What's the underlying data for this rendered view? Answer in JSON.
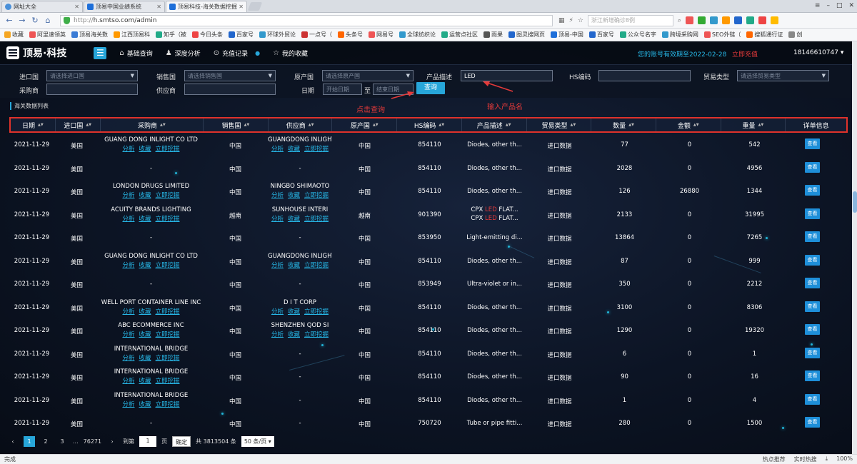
{
  "browser": {
    "tabs": [
      {
        "title": "网址大全",
        "color": "#4a90d9"
      },
      {
        "title": "顶易中国业绩系统",
        "color": "#1e6fd9"
      },
      {
        "title": "顶易科技-海关数据挖掘",
        "color": "#1e6fd9"
      }
    ],
    "window_controls": [
      "≡",
      "–",
      "□",
      "✕"
    ],
    "url_protocol": "http://",
    "url_host": "h.smtso.com/admin",
    "search_placeholder": "浙江新增确诊8例",
    "bookmarks": [
      "收藏",
      "阿里速领英",
      "顶易海关数",
      "江西顶易科",
      "知乎（被",
      "今日头条",
      "百家号",
      "环球外贸论",
      "一点号（",
      "头条号",
      "网易号",
      "全球纺织论",
      "运营点社区",
      "雨果",
      "图灵搜网页",
      "顶易-中国",
      "百家号",
      "公众号名字",
      "跨境采购网",
      "SEO外链（",
      "搜狐通行证",
      "创"
    ]
  },
  "app": {
    "brand": "顶易·科技",
    "nav": [
      {
        "icon": "⌂",
        "label": "基础查询"
      },
      {
        "icon": "♟",
        "label": "深度分析"
      },
      {
        "icon": "⊙",
        "label": "充值记录"
      },
      {
        "icon": "☆",
        "label": "我的收藏"
      }
    ],
    "account_expiry": "您的账号有效期至2022-02-28",
    "renew_label": "立即充值",
    "username": "18146610747",
    "filters": {
      "import_country": {
        "label": "进口国",
        "placeholder": "请选择进口国"
      },
      "export_country": {
        "label": "销售国",
        "placeholder": "请选择销售国"
      },
      "origin_country": {
        "label": "原产国",
        "placeholder": "请选择原产国"
      },
      "product_desc": {
        "label": "产品描述",
        "value": "LED"
      },
      "hs_code": {
        "label": "HS编码",
        "value": ""
      },
      "trade_type": {
        "label": "贸易类型",
        "placeholder": "请选择贸易类型"
      },
      "buyer": {
        "label": "采购商",
        "value": ""
      },
      "supplier": {
        "label": "供应商",
        "value": ""
      },
      "date": {
        "label": "日期",
        "start_placeholder": "开始日期",
        "to": "至",
        "end_placeholder": "结束日期"
      },
      "query_button": "查询"
    },
    "annotations": {
      "click_query": "点击查询",
      "enter_product": "输入产品名"
    },
    "list_title": "海关数据列表",
    "columns": [
      "日期",
      "进口国",
      "采购商",
      "销售国",
      "供应商",
      "原产国",
      "HS编码",
      "产品描述",
      "贸易类型",
      "数量",
      "金额",
      "重量",
      "详单信息"
    ],
    "link_labels": {
      "analyze": "分析",
      "favorite": "收藏",
      "mine": "立即挖掘"
    },
    "view_label": "查看",
    "rows": [
      {
        "date": "2021-11-29",
        "importer": "美国",
        "buyer": "GUANG DONG INLIGHT CO LTD",
        "buyer_links": true,
        "seller_country": "中国",
        "supplier": "GUANGDONG INLIGHT",
        "supplier_links": true,
        "origin": "中国",
        "hs": "854110",
        "desc": "Diodes, other th...",
        "trade": "进口数据",
        "qty": "77",
        "amount": "0",
        "weight": "542"
      },
      {
        "date": "2021-11-29",
        "importer": "美国",
        "buyer": "-",
        "buyer_links": false,
        "seller_country": "中国",
        "supplier": "-",
        "supplier_links": false,
        "origin": "中国",
        "hs": "854110",
        "desc": "Diodes, other th...",
        "trade": "进口数据",
        "qty": "2028",
        "amount": "0",
        "weight": "4956"
      },
      {
        "date": "2021-11-29",
        "importer": "美国",
        "buyer": "LONDON DRUGS LIMITED",
        "buyer_links": true,
        "seller_country": "中国",
        "supplier": "NINGBO SHIMAOTO",
        "supplier_links": true,
        "origin": "中国",
        "hs": "854110",
        "desc": "Diodes, other th...",
        "trade": "进口数据",
        "qty": "126",
        "amount": "26880",
        "weight": "1344"
      },
      {
        "date": "2021-11-29",
        "importer": "美国",
        "buyer": "ACUITY BRANDS LIGHTING",
        "buyer_links": true,
        "seller_country": "越南",
        "supplier": "SUNHOUSE INTERI",
        "supplier_links": true,
        "origin": "越南",
        "hs": "901390",
        "desc": "",
        "desc_pre": "CPX ",
        "desc_hl": "LED",
        "desc_post": " FLAT...",
        "desc2_pre": "CPX ",
        "desc2_hl": "LED",
        "desc2_post": " FLAT...",
        "trade": "进口数据",
        "qty": "2133",
        "amount": "0",
        "weight": "31995"
      },
      {
        "date": "2021-11-29",
        "importer": "美国",
        "buyer": "-",
        "buyer_links": false,
        "seller_country": "中国",
        "supplier": "-",
        "supplier_links": false,
        "origin": "中国",
        "hs": "853950",
        "desc": "Light-emitting di...",
        "trade": "进口数据",
        "qty": "13864",
        "amount": "0",
        "weight": "7265"
      },
      {
        "date": "2021-11-29",
        "importer": "美国",
        "buyer": "GUANG DONG INLIGHT CO LTD",
        "buyer_links": true,
        "seller_country": "中国",
        "supplier": "GUANGDONG INLIGHT",
        "supplier_links": true,
        "origin": "中国",
        "hs": "854110",
        "desc": "Diodes, other th...",
        "trade": "进口数据",
        "qty": "87",
        "amount": "0",
        "weight": "999"
      },
      {
        "date": "2021-11-29",
        "importer": "美国",
        "buyer": "-",
        "buyer_links": false,
        "seller_country": "中国",
        "supplier": "-",
        "supplier_links": false,
        "origin": "中国",
        "hs": "853949",
        "desc": "Ultra-violet or in...",
        "trade": "进口数据",
        "qty": "350",
        "amount": "0",
        "weight": "2212"
      },
      {
        "date": "2021-11-29",
        "importer": "美国",
        "buyer": "WELL PORT CONTAINER LINE INC",
        "buyer_links": true,
        "seller_country": "中国",
        "supplier": "D I T CORP",
        "supplier_links": true,
        "origin": "中国",
        "hs": "854110",
        "desc": "Diodes, other th...",
        "trade": "进口数据",
        "qty": "3100",
        "amount": "0",
        "weight": "8306"
      },
      {
        "date": "2021-11-29",
        "importer": "美国",
        "buyer": "ABC ECOMMERCE INC",
        "buyer_links": true,
        "seller_country": "中国",
        "supplier": "SHENZHEN QOD SI",
        "supplier_links": true,
        "origin": "中国",
        "hs": "854110",
        "desc": "Diodes, other th...",
        "trade": "进口数据",
        "qty": "1290",
        "amount": "0",
        "weight": "19320"
      },
      {
        "date": "2021-11-29",
        "importer": "美国",
        "buyer": "INTERNATIONAL BRIDGE",
        "buyer_links": true,
        "seller_country": "中国",
        "supplier": "-",
        "supplier_links": false,
        "origin": "中国",
        "hs": "854110",
        "desc": "Diodes, other th...",
        "trade": "进口数据",
        "qty": "6",
        "amount": "0",
        "weight": "1"
      },
      {
        "date": "2021-11-29",
        "importer": "美国",
        "buyer": "INTERNATIONAL BRIDGE",
        "buyer_links": true,
        "seller_country": "中国",
        "supplier": "-",
        "supplier_links": false,
        "origin": "中国",
        "hs": "854110",
        "desc": "Diodes, other th...",
        "trade": "进口数据",
        "qty": "90",
        "amount": "0",
        "weight": "16"
      },
      {
        "date": "2021-11-29",
        "importer": "美国",
        "buyer": "INTERNATIONAL BRIDGE",
        "buyer_links": true,
        "seller_country": "中国",
        "supplier": "-",
        "supplier_links": false,
        "origin": "中国",
        "hs": "854110",
        "desc": "Diodes, other th...",
        "trade": "进口数据",
        "qty": "1",
        "amount": "0",
        "weight": "4"
      },
      {
        "date": "2021-11-29",
        "importer": "美国",
        "buyer": "-",
        "buyer_links": false,
        "seller_country": "中国",
        "supplier": "-",
        "supplier_links": false,
        "origin": "中国",
        "hs": "750720",
        "desc": "Tube or pipe fitti...",
        "trade": "进口数据",
        "qty": "280",
        "amount": "0",
        "weight": "1500"
      }
    ],
    "pagination": {
      "prev": "‹",
      "pages": [
        "1",
        "2",
        "3"
      ],
      "ellipsis": "...",
      "last": "76271",
      "next": "›",
      "goto_label": "到第",
      "goto_value": "1",
      "page_unit": "页",
      "ok": "确定",
      "total": "共 3813504 条",
      "page_size": "50 条/页"
    }
  },
  "status": {
    "left": "完成",
    "hot": "热点推荐",
    "hotsearch": "实时热搜",
    "zoom": "100%"
  }
}
